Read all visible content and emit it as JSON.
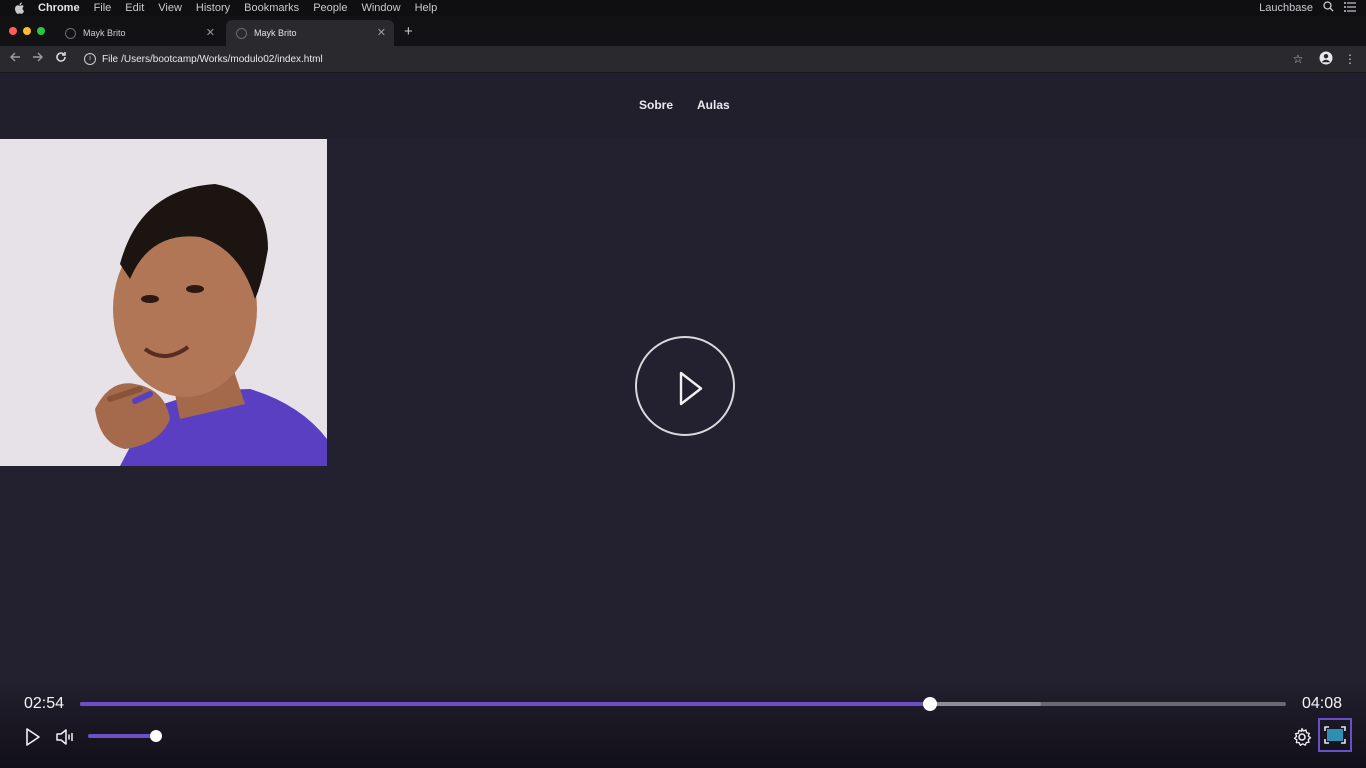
{
  "menubar": {
    "app_name": "Chrome",
    "items": [
      "File",
      "Edit",
      "View",
      "History",
      "Bookmarks",
      "People",
      "Window",
      "Help"
    ],
    "right_label": "Lauchbase"
  },
  "tabs": [
    {
      "title": "Mayk Brito",
      "active": false
    },
    {
      "title": "Mayk Brito",
      "active": true
    }
  ],
  "address_bar": {
    "scheme_label": "File",
    "url": "/Users/bootcamp/Works/modulo02/index.html"
  },
  "page": {
    "nav": {
      "items": [
        "Sobre",
        "Aulas"
      ]
    },
    "photo_subject": "Mayk Brito portrait"
  },
  "player": {
    "current_time": "02:54",
    "duration": "04:08",
    "progress_fraction": 0.705,
    "buffered_fraction": 0.797,
    "volume_fraction": 1.0,
    "accent_color": "#6a4fc8"
  },
  "colors": {
    "page_background": "#23202f",
    "header_background": "#221f2d"
  }
}
